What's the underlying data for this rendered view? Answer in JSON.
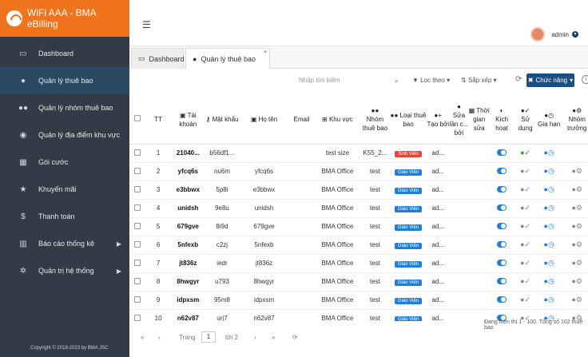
{
  "app": {
    "title": "WiFi AAA - BMA eBilling"
  },
  "sidebar": {
    "items": [
      {
        "label": "Dashboard",
        "icon": "monitor-icon"
      },
      {
        "label": "Quản lý thuê bao",
        "icon": "user-icon"
      },
      {
        "label": "Quản lý nhóm thuê bao",
        "icon": "users-icon"
      },
      {
        "label": "Quản lý địa điểm khu vực",
        "icon": "location-icon"
      },
      {
        "label": "Gói cước",
        "icon": "calculator-icon"
      },
      {
        "label": "Khuyến mãi",
        "icon": "star-icon"
      },
      {
        "label": "Thanh toán",
        "icon": "dollar-icon"
      },
      {
        "label": "Báo cáo thống kê",
        "icon": "bar-chart-icon"
      },
      {
        "label": "Quản trị hệ thống",
        "icon": "cogs-icon"
      }
    ],
    "copyright": "Copyright © 2019-2023 by BMA JSC"
  },
  "topbar": {
    "username": "admin"
  },
  "tabs": [
    {
      "label": "Dashboard"
    },
    {
      "label": "Quản lý thuê bao"
    }
  ],
  "toolbar": {
    "search_placeholder": "Nhập tìm kiếm",
    "filter_label": "Lọc theo",
    "sort_label": "Sắp xếp",
    "function_label": "Chức năng"
  },
  "table": {
    "headers": {
      "tt": "TT",
      "account": "Tài khoản",
      "password": "Mật khẩu",
      "fullname": "Họ tên",
      "email": "Email",
      "area": "Khu vực",
      "group": "Nhóm thuê bao",
      "type": "Loại thuê bao",
      "creator": "Tạo bởi",
      "edited_by": "Sửa lần c... bởi",
      "edit_time": "Thời gian sửa",
      "active": "Kích hoạt",
      "using": "Sử dụng",
      "extend": "Gia hạn",
      "leader": "Nhóm trưởng"
    },
    "rows": [
      {
        "tt": "1",
        "account": "21040...",
        "password": "b56df1...",
        "fullname": "",
        "area": "test size",
        "group": "K55_2...",
        "type": "Sinh Viên",
        "creator": "ad..."
      },
      {
        "tt": "2",
        "account": "yfcq6s",
        "password": "nu6m",
        "fullname": "yfcq6s",
        "area": "BMA Office",
        "group": "test",
        "type": "Giáo Viên",
        "creator": "ad..."
      },
      {
        "tt": "3",
        "account": "e3bbwx",
        "password": "5p8i",
        "fullname": "e3bbwx",
        "area": "BMA Office",
        "group": "test",
        "type": "Giáo Viên",
        "creator": "ad..."
      },
      {
        "tt": "4",
        "account": "unidsh",
        "password": "9e8u",
        "fullname": "unidsh",
        "area": "BMA Office",
        "group": "test",
        "type": "Giáo Viên",
        "creator": "ad..."
      },
      {
        "tt": "5",
        "account": "679gve",
        "password": "8i9d",
        "fullname": "679gve",
        "area": "BMA Office",
        "group": "test",
        "type": "Giáo Viên",
        "creator": "ad..."
      },
      {
        "tt": "6",
        "account": "5nfexb",
        "password": "c2zj",
        "fullname": "5nfexb",
        "area": "BMA Office",
        "group": "test",
        "type": "Giáo Viên",
        "creator": "ad..."
      },
      {
        "tt": "7",
        "account": "jt836z",
        "password": "iedr",
        "fullname": "jt836z",
        "area": "BMA Office",
        "group": "test",
        "type": "Giáo Viên",
        "creator": "ad..."
      },
      {
        "tt": "8",
        "account": "8hwgyr",
        "password": "u793",
        "fullname": "8hwgyr",
        "area": "BMA Office",
        "group": "test",
        "type": "Giáo Viên",
        "creator": "ad..."
      },
      {
        "tt": "9",
        "account": "idpxsm",
        "password": "95m8",
        "fullname": "idpxsm",
        "area": "BMA Office",
        "group": "test",
        "type": "Giáo Viên",
        "creator": "ad..."
      },
      {
        "tt": "10",
        "account": "n62v87",
        "password": "urj7",
        "fullname": "n62v87",
        "area": "BMA Office",
        "group": "test",
        "type": "Giáo Viên",
        "creator": "ad..."
      }
    ]
  },
  "footer": {
    "page_label": "Trang",
    "page_value": "1",
    "page_total": "tới 2",
    "summary": "Đang hiển thị 1 - 100. Tổng số 102 thuê bao"
  }
}
